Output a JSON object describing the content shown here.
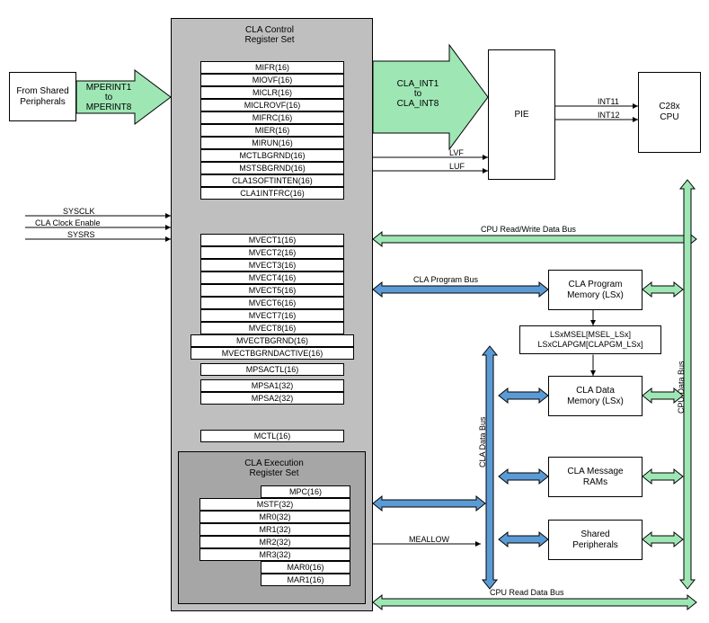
{
  "peripheral_box": "From Shared\nPeripherals",
  "mperint_label": "MPERINT1\nto\nMPERINT8",
  "cla_control_title": "CLA Control\nRegister Set",
  "cla_exec_title": "CLA Execution\nRegister Set",
  "cla_int_label": "CLA_INT1\nto\nCLA_INT8",
  "pie": "PIE",
  "cpu": "C28x\nCPU",
  "cla_prog_mem": "CLA Program\nMemory (LSx)",
  "lsx_labels": "LSxMSEL[MSEL_LSx]\nLSxCLAPGM[CLAPGM_LSx]",
  "cla_data_mem": "CLA Data\nMemory (LSx)",
  "cla_msg_rams": "CLA Message\nRAMs",
  "shared_periph": "Shared\nPeripherals",
  "signals": {
    "sysclk": "SYSCLK",
    "cla_clk_en": "CLA Clock Enable",
    "sysrs": "SYSRS",
    "lvf": "LVF",
    "luf": "LUF",
    "int11": "INT11",
    "int12": "INT12",
    "meallow": "MEALLOW"
  },
  "buses": {
    "cpu_rw": "CPU Read/Write Data Bus",
    "cla_prog": "CLA Program Bus",
    "cla_data": "CLA Data Bus",
    "cpu_data": "CPU Data Bus",
    "cpu_read": "CPU Read Data Bus"
  },
  "regs_top": [
    "MIFR(16)",
    "MIOVF(16)",
    "MICLR(16)",
    "MICLROVF(16)",
    "MIFRC(16)",
    "MIER(16)",
    "MIRUN(16)",
    "MCTLBGRND(16)",
    "MSTSBGRND(16)",
    "CLA1SOFTINTEN(16)",
    "CLA1INTFRC(16)"
  ],
  "regs_mid": [
    "MVECT1(16)",
    "MVECT2(16)",
    "MVECT3(16)",
    "MVECT4(16)",
    "MVECT5(16)",
    "MVECT6(16)",
    "MVECT7(16)",
    "MVECT8(16)",
    "MVECTBGRND(16)",
    "MVECTBGRNDACTIVE(16)",
    "MPSACTL(16)",
    "MPSA1(32)",
    "MPSA2(32)"
  ],
  "regs_mctl": "MCTL(16)",
  "regs_exec_mpc": "MPC(16)",
  "regs_exec": [
    "MSTF(32)",
    "MR0(32)",
    "MR1(32)",
    "MR2(32)",
    "MR3(32)"
  ],
  "regs_mar": [
    "MAR0(16)",
    "MAR1(16)"
  ]
}
